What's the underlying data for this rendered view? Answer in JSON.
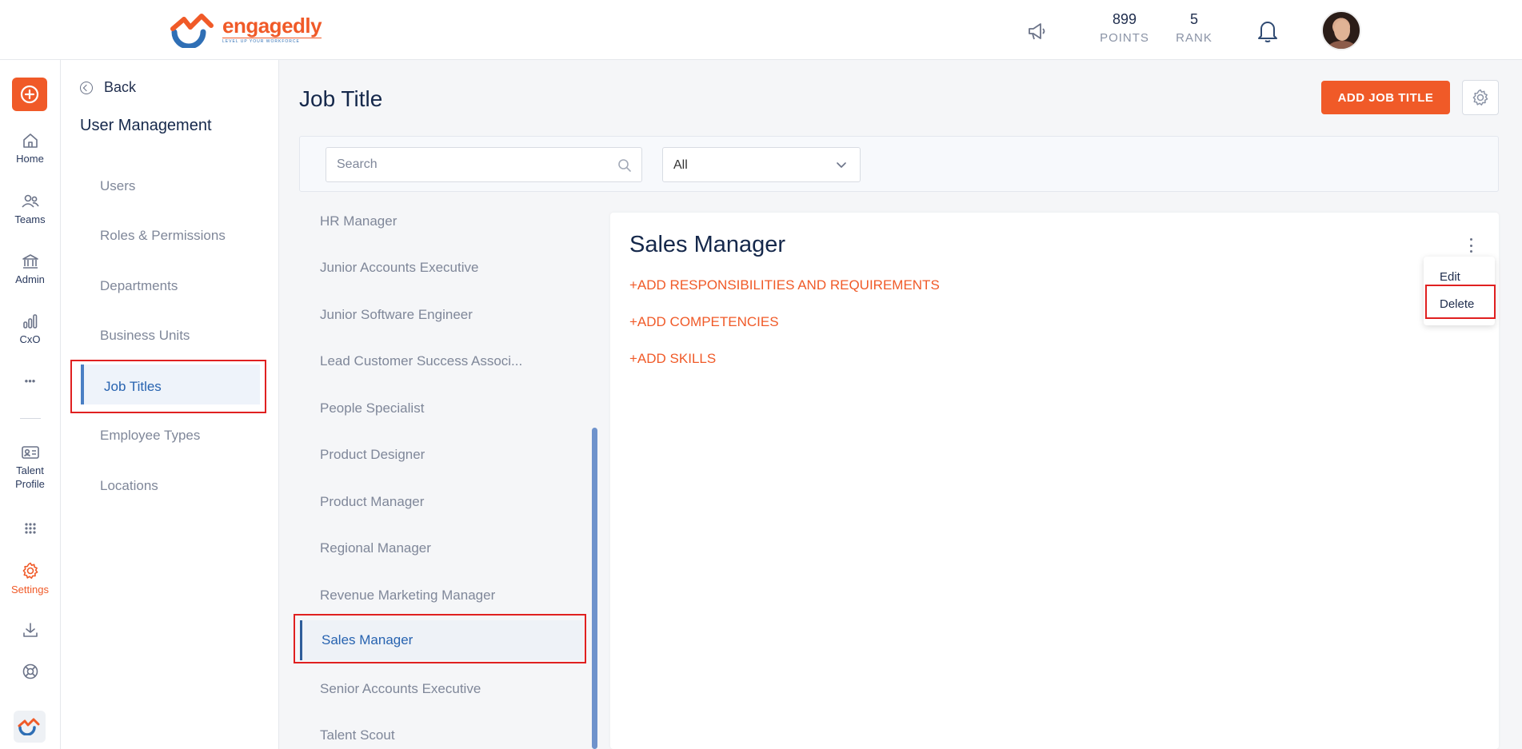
{
  "header": {
    "logo_text": "engagedly",
    "logo_tagline": "LEVEL UP YOUR WORKFORCE",
    "points_value": "899",
    "points_label": "POINTS",
    "rank_value": "5",
    "rank_label": "RANK"
  },
  "rail": {
    "items": [
      {
        "label": "Home"
      },
      {
        "label": "Teams"
      },
      {
        "label": "Admin"
      },
      {
        "label": "CxO"
      },
      {
        "label": "Talent Profile"
      },
      {
        "label": "Settings"
      }
    ],
    "more": "•••"
  },
  "submenu": {
    "back_label": "Back",
    "title": "User Management",
    "items": [
      "Users",
      "Roles & Permissions",
      "Departments",
      "Business Units",
      "Job Titles",
      "Employee Types",
      "Locations"
    ],
    "active": "Job Titles"
  },
  "main": {
    "title": "Job Title",
    "add_button": "ADD JOB TITLE",
    "search_placeholder": "Search",
    "filter_value": "All"
  },
  "job_titles": [
    "HR Manager",
    "Junior Accounts Executive",
    "Junior Software Engineer",
    "Lead Customer Success Associ...",
    "People Specialist",
    "Product Designer",
    "Product Manager",
    "Regional Manager",
    "Revenue Marketing Manager",
    "Sales Manager",
    "Senior Accounts Executive",
    "Talent Scout"
  ],
  "selected_job": "Sales Manager",
  "detail": {
    "title": "Sales Manager",
    "add_responsibilities": "+ADD RESPONSIBILITIES AND REQUIREMENTS",
    "add_competencies": "+ADD COMPETENCIES",
    "add_skills": "+ADD SKILLS"
  },
  "menu": {
    "edit": "Edit",
    "delete": "Delete"
  },
  "colors": {
    "accent": "#f05a28",
    "navy": "#15284b",
    "active_blue": "#2763b0",
    "highlight": "#e02020"
  }
}
